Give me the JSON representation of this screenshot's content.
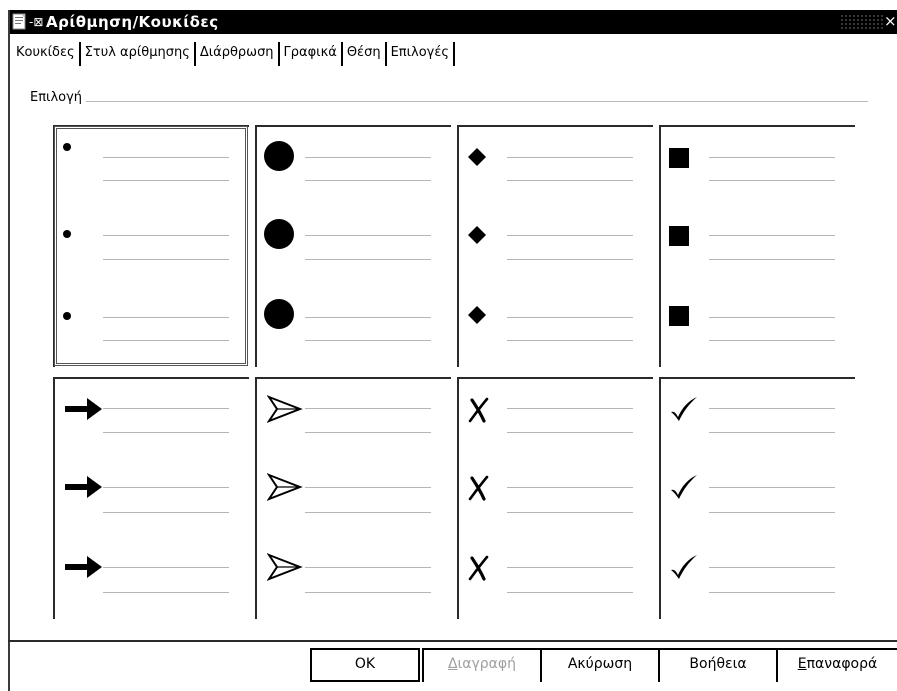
{
  "window": {
    "title": "Αρίθμηση/Κουκίδες",
    "pin_glyph": "-⊠",
    "close_glyph": "×"
  },
  "tabs": [
    {
      "label": "Κουκίδες",
      "active": true
    },
    {
      "label": "Στυλ αρίθμησης",
      "active": false
    },
    {
      "label": "Διάρθρωση",
      "active": false
    },
    {
      "label": "Γραφικά",
      "active": false
    },
    {
      "label": "Θέση",
      "active": false
    },
    {
      "label": "Επιλογές",
      "active": false
    }
  ],
  "selection": {
    "label": "Επιλογή",
    "options": [
      {
        "name": "small-dot",
        "glyph": "•",
        "selected": true
      },
      {
        "name": "large-circle",
        "glyph": "●",
        "selected": false
      },
      {
        "name": "diamond",
        "glyph": "◆",
        "selected": false
      },
      {
        "name": "square",
        "glyph": "■",
        "selected": false
      },
      {
        "name": "bold-arrow",
        "glyph": "➔",
        "selected": false
      },
      {
        "name": "arrowhead",
        "glyph": "➢",
        "selected": false
      },
      {
        "name": "cross",
        "glyph": "✗",
        "selected": false
      },
      {
        "name": "checkmark",
        "glyph": "✔",
        "selected": false
      }
    ]
  },
  "buttons": {
    "ok": "OK",
    "delete": "Διαγραφή",
    "cancel": "Ακύρωση",
    "help": "Βοήθεια",
    "reset": "Επαναφορά"
  },
  "colors": {
    "titlebar": "#000000",
    "disabled_text": "#a0a0a0",
    "preview_line": "#b5b5b5"
  }
}
